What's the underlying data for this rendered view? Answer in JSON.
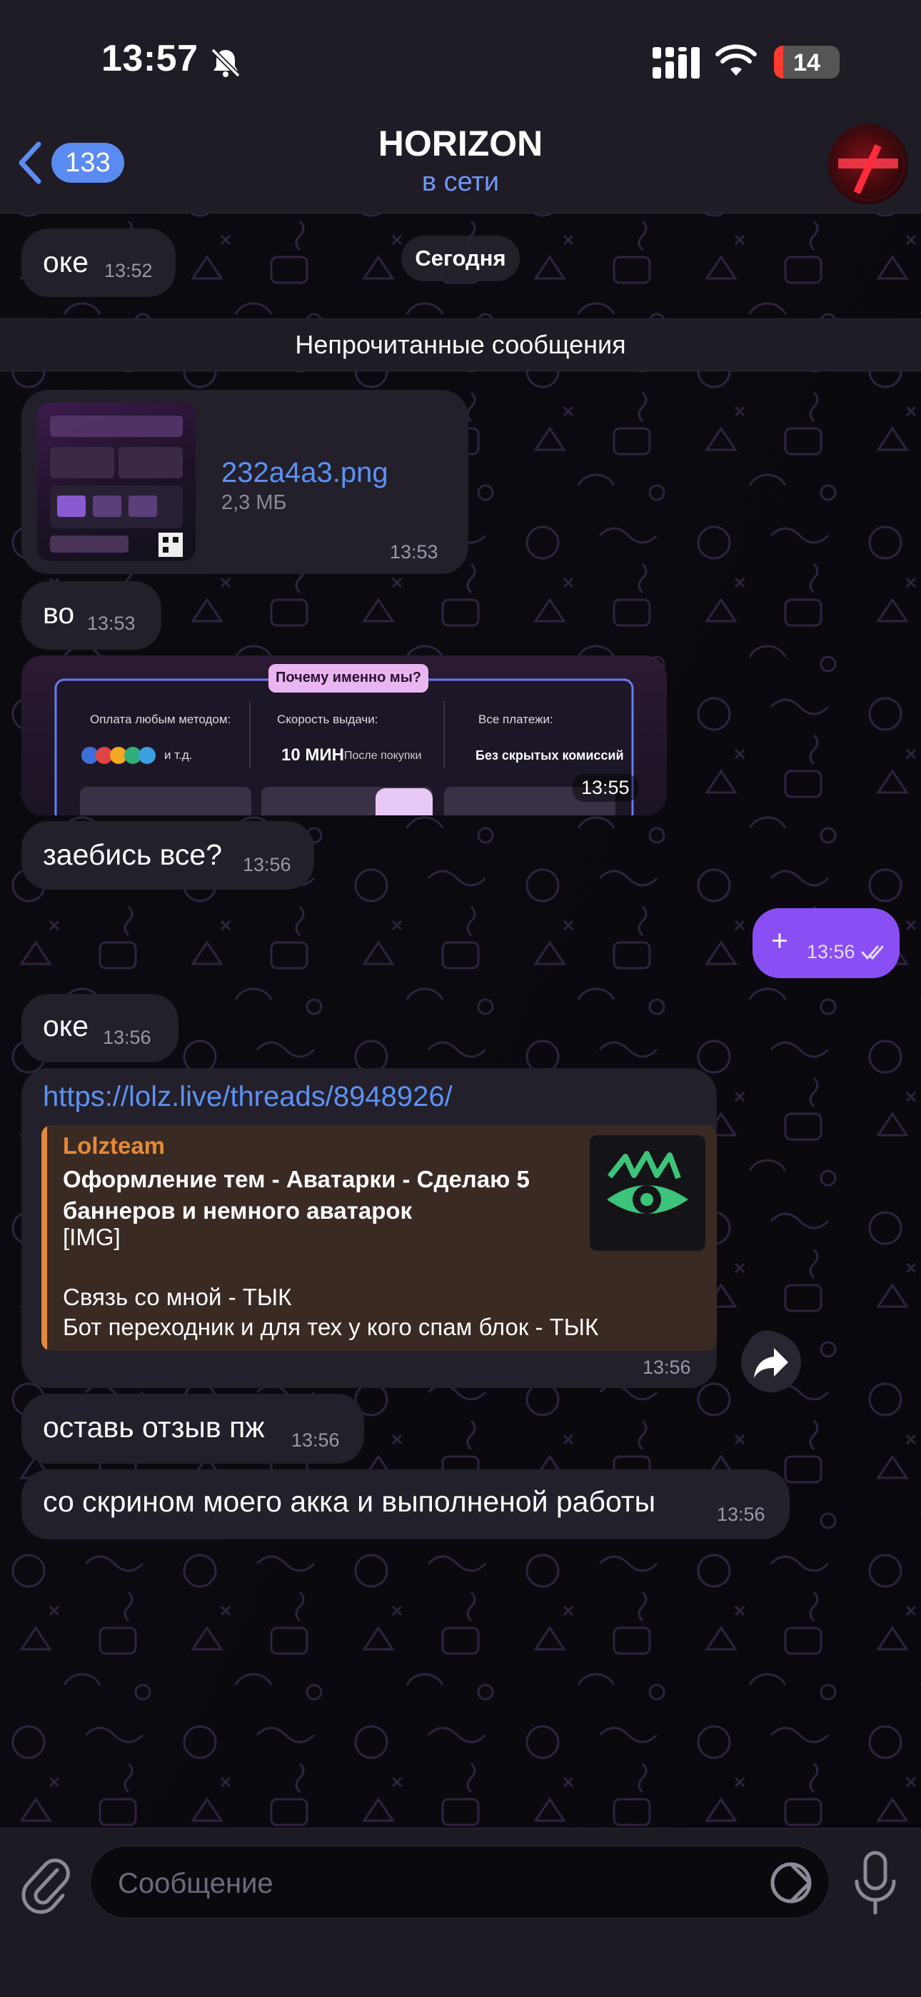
{
  "status_bar": {
    "time": "13:57",
    "battery": "14",
    "battery_level": 0.14,
    "icons": [
      "bell-slash-icon",
      "cellular-signal-icon",
      "wifi-icon",
      "battery-icon"
    ]
  },
  "header": {
    "back_count": "133",
    "title": "HORIZON",
    "status": "в сети",
    "icons": [
      "chevron-left-icon",
      "avatar"
    ]
  },
  "date_pill": "Сегодня",
  "unread_label": "Непрочитанные сообщения",
  "messages": {
    "m1": {
      "text": "оке",
      "time": "13:52"
    },
    "file": {
      "name": "232a4a3.png",
      "size": "2,3 МБ",
      "time": "13:53"
    },
    "m2": {
      "text": "во",
      "time": "13:53"
    },
    "image": {
      "time": "13:55",
      "heading": "Почему именно мы?",
      "col1_label": "Оплата любым методом:",
      "col1_value": "и т.д.",
      "col2_label": "Скорость выдачи:",
      "col2_value": "10 МИН",
      "col2_sub": "После покупки",
      "col3_label": "Все платежи:",
      "col3_value": "Без скрытых комиссий"
    },
    "m3": {
      "text": "заебись все?",
      "time": "13:56"
    },
    "out1": {
      "text": "+",
      "time": "13:56"
    },
    "m4": {
      "text": "оке",
      "time": "13:56"
    },
    "link": {
      "url": "https://lolz.live/threads/8948926/",
      "site": "Lolzteam",
      "title": "Оформление тем - Аватарки - Сделаю 5 баннеров и немного аватарок",
      "line1": "[IMG]",
      "line2": "Связь со мной - ТЫК",
      "line3": "Бот переходник и для тех у кого спам блок - ТЫК",
      "time": "13:56"
    },
    "m5": {
      "text": "оставь отзыв пж",
      "time": "13:56"
    },
    "m6": {
      "text": "со скрином моего акка и выполненой работы",
      "time": "13:56"
    }
  },
  "composer": {
    "placeholder": "Сообщение",
    "icons": [
      "paperclip-icon",
      "sticker-icon",
      "microphone-icon"
    ]
  },
  "colors": {
    "accent": "#8a4ef5",
    "link": "#5c92f2",
    "incoming_bubble": "#231f2b",
    "preview_accent": "#e58a37"
  }
}
